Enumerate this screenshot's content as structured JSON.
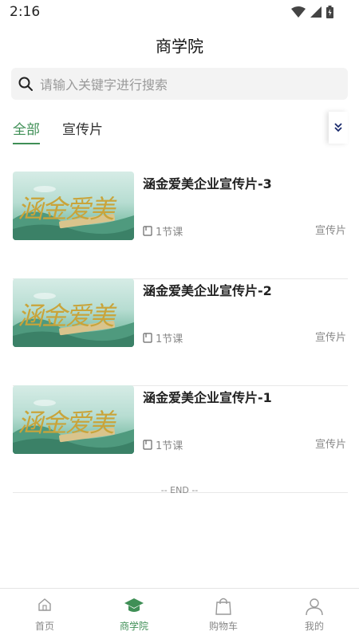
{
  "status_bar": {
    "time": "2:16"
  },
  "header": {
    "title": "商学院"
  },
  "search": {
    "placeholder": "请输入关键字进行搜索"
  },
  "tabs": [
    {
      "label": "全部",
      "active": true
    },
    {
      "label": "宣传片",
      "active": false
    }
  ],
  "expand_icon": "chevron-double-down-icon",
  "courses": [
    {
      "title": "涵金爱美企业宣传片-3",
      "lessons": "1节课",
      "tag": "宣传片",
      "thumb_text": "涵金爱美"
    },
    {
      "title": "涵金爱美企业宣传片-2",
      "lessons": "1节课",
      "tag": "宣传片",
      "thumb_text": "涵金爱美"
    },
    {
      "title": "涵金爱美企业宣传片-1",
      "lessons": "1节课",
      "tag": "宣传片",
      "thumb_text": "涵金爱美"
    }
  ],
  "end_text": "-- END --",
  "bottom_nav": [
    {
      "label": "首页",
      "icon": "home-icon",
      "active": false
    },
    {
      "label": "商学院",
      "icon": "graduation-cap-icon",
      "active": true
    },
    {
      "label": "购物车",
      "icon": "shopping-bag-icon",
      "active": false
    },
    {
      "label": "我的",
      "icon": "person-icon",
      "active": false
    }
  ],
  "colors": {
    "accent": "#3f8f56",
    "muted": "#888888",
    "search_bg": "#f3f3f3"
  }
}
